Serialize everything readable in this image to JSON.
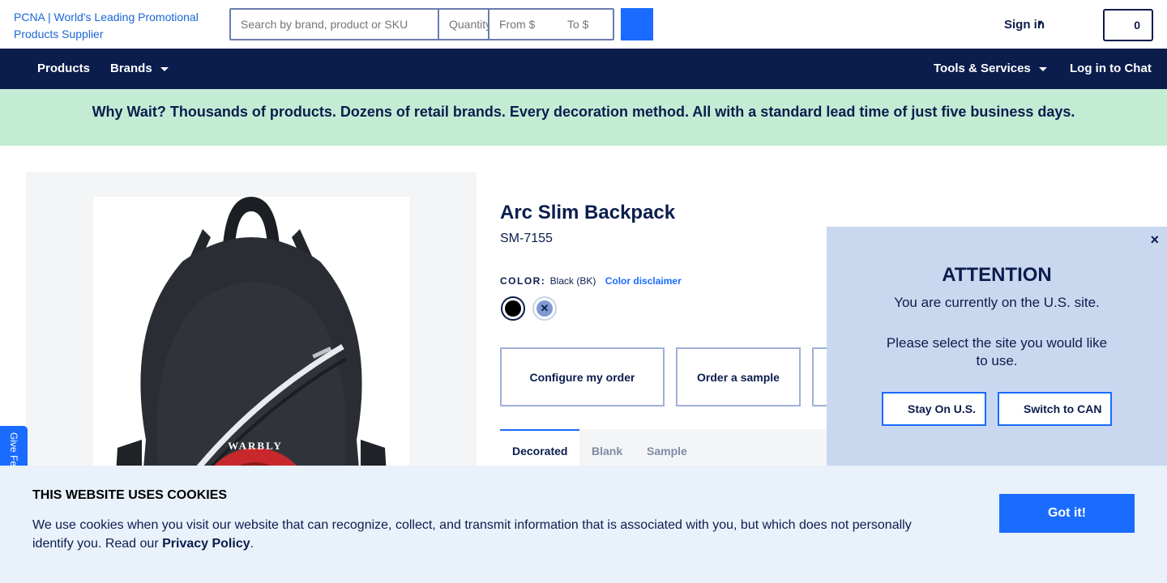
{
  "header": {
    "logo_alt": "PCNA | World's Leading Promotional Products Supplier",
    "search_placeholder": "Search by brand, product or SKU",
    "quantity_placeholder": "Quantity",
    "from_placeholder": "From $",
    "to_placeholder": "To $",
    "sign_in": "Sign in",
    "cart_count": "0"
  },
  "nav": {
    "products": "Products",
    "brands": "Brands",
    "tools": "Tools & Services",
    "chat": "Log in to Chat"
  },
  "banner": {
    "text": "Why Wait? Thousands of products. Dozens of retail brands. Every decoration method. All with a standard lead time of just five business days."
  },
  "product": {
    "title": "Arc Slim Backpack",
    "sku": "SM-7155",
    "color_label": "COLOR:",
    "color_value": "Black (BK)",
    "color_disclaimer": "Color disclaimer",
    "swatches": [
      {
        "name": "Black",
        "color": "#000000"
      },
      {
        "name": "Blue",
        "color": "#7f9ad0"
      }
    ],
    "actions": [
      "Configure my order",
      "Order a sample"
    ],
    "tabs": [
      "Decorated",
      "Blank",
      "Sample"
    ],
    "image_text": "WARBLY"
  },
  "feedback": {
    "label": "Give Feedback"
  },
  "popup": {
    "close": "×",
    "heading": "ATTENTION",
    "line1": "You are currently on the U.S. site.",
    "line2": "Please select the site you would like to use.",
    "stay": "Stay On U.S.",
    "switch": "Switch to CAN"
  },
  "cookie": {
    "title": "THIS WEBSITE USES COOKIES",
    "body": "We use cookies when you visit our website that can recognize, collect, and transmit information that is associated with you, but which does not personally identify you. Read our ",
    "link": "Privacy Policy",
    "period": ".",
    "button": "Got it!"
  },
  "colors": {
    "navy": "#0b1d4d",
    "accent_blue": "#1a6bff",
    "banner_green": "#c4ecd4",
    "popup_bg": "#c9d8ef",
    "cookie_bg": "#e9f1fb"
  }
}
